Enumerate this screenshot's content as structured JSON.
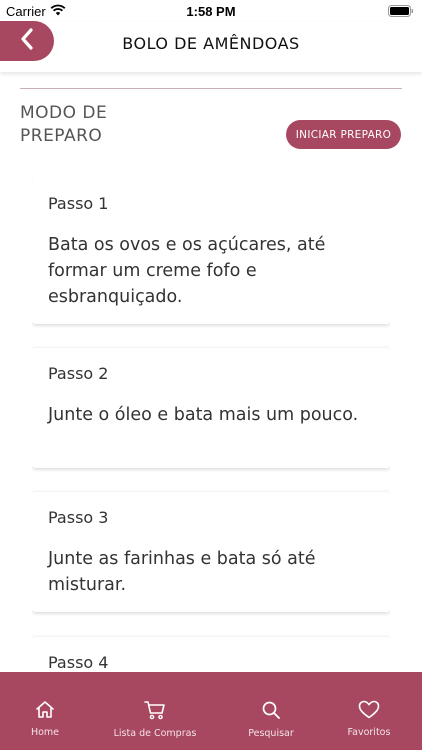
{
  "status": {
    "carrier": "Carrier",
    "time": "1:58 PM"
  },
  "header": {
    "title": "BOLO DE AMÊNDOAS"
  },
  "section": {
    "title": "MODO DE PREPARO",
    "start_button": "INICIAR PREPARO"
  },
  "steps": [
    {
      "label": "Passo 1",
      "text": "Bata os ovos e os açúcares, até formar um creme fofo e esbranquiçado."
    },
    {
      "label": "Passo 2",
      "text": "Junte o óleo e bata mais um pouco."
    },
    {
      "label": "Passo 3",
      "text": "Junte as farinhas e bata só até misturar."
    },
    {
      "label": "Passo 4",
      "text": ""
    }
  ],
  "tabs": [
    {
      "label": "Home",
      "icon": "home-icon"
    },
    {
      "label": "Lista de Compras",
      "icon": "cart-icon"
    },
    {
      "label": "Pesquisar",
      "icon": "search-icon"
    },
    {
      "label": "Favoritos",
      "icon": "heart-icon"
    }
  ],
  "colors": {
    "accent": "#a84760",
    "tab_label": "#f3e4e8"
  }
}
